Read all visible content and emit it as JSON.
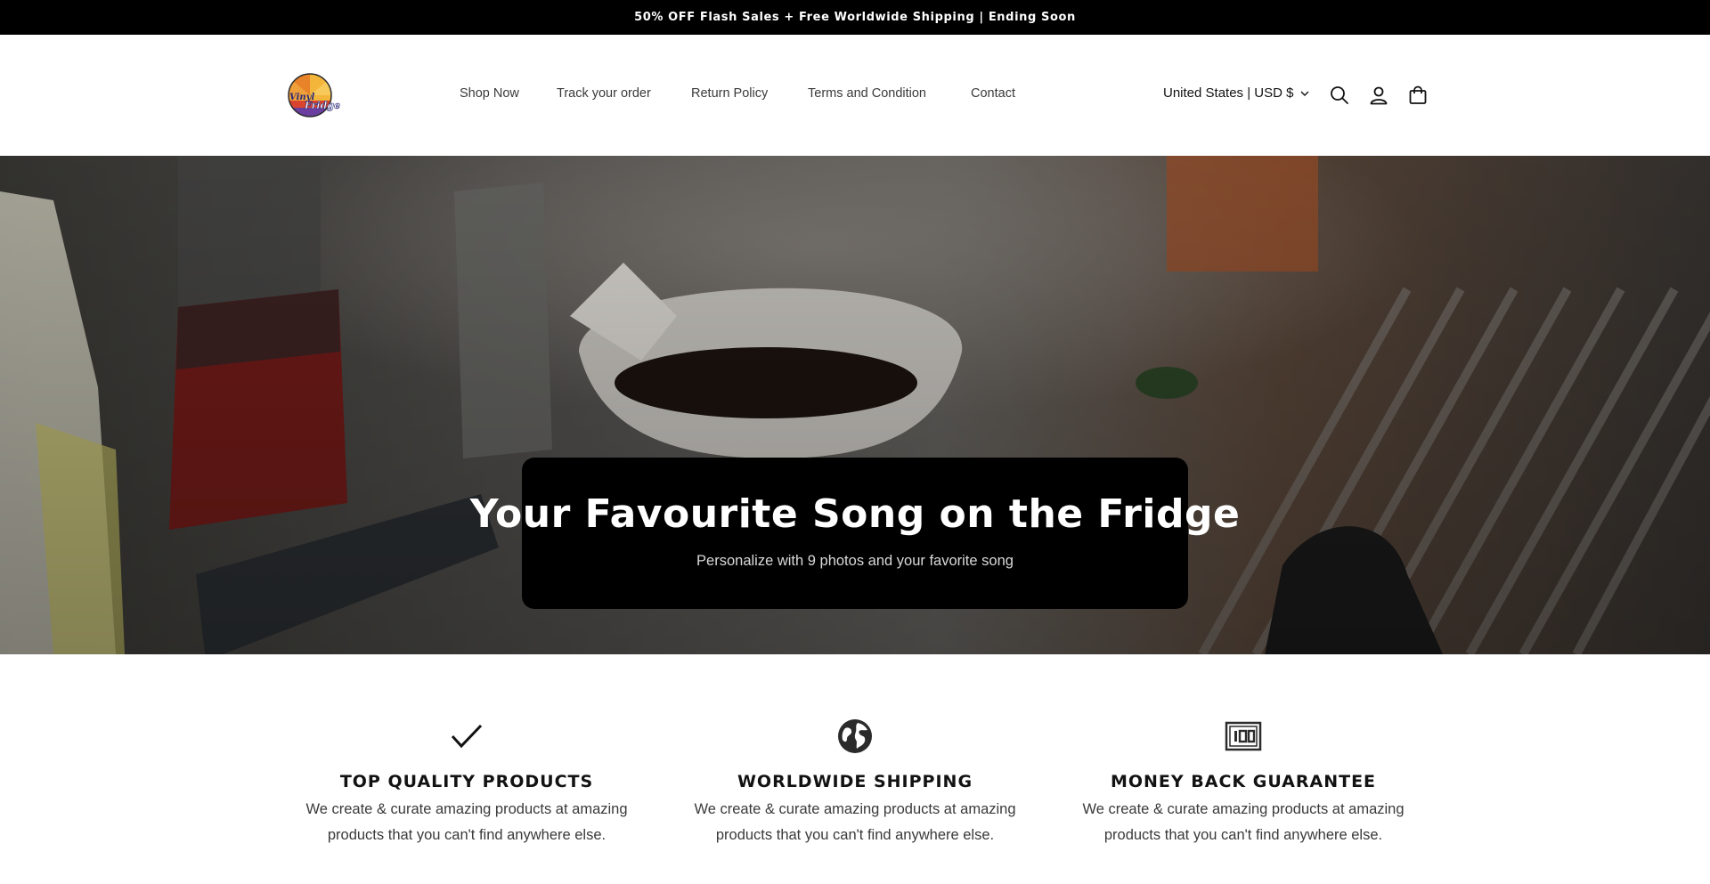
{
  "announcement": {
    "text": "50% OFF Flash Sales + Free Worldwide Shipping | Ending Soon"
  },
  "header": {
    "logo_alt": "Vinyl Fridge",
    "nav": [
      {
        "label": "Shop Now"
      },
      {
        "label": "Track your order"
      },
      {
        "label": "Return Policy"
      },
      {
        "label": "Terms and Condition"
      },
      {
        "label": "Contact"
      }
    ],
    "locale": "United States | USD $",
    "icons": [
      "search-icon",
      "account-icon",
      "cart-icon"
    ]
  },
  "hero": {
    "title": "Your Favourite Song on the Fridge",
    "subtitle": "Personalize with 9 photos and your favorite song"
  },
  "features": [
    {
      "icon": "checkmark-icon",
      "title": "TOP QUALITY PRODUCTS",
      "text": "We create & curate amazing products at amazing products that you can't find anywhere else."
    },
    {
      "icon": "globe-icon",
      "title": "WORLDWIDE SHIPPING",
      "text": "We create & curate amazing products at amazing products that you can't find anywhere else."
    },
    {
      "icon": "money-100-icon",
      "title": "MONEY BACK GUARANTEE",
      "text": "We create & curate amazing products at amazing products that you can't find anywhere else."
    }
  ],
  "colors": {
    "announcement_bg": "#000000",
    "hero_box_bg": "#000000",
    "text": "#121212"
  }
}
